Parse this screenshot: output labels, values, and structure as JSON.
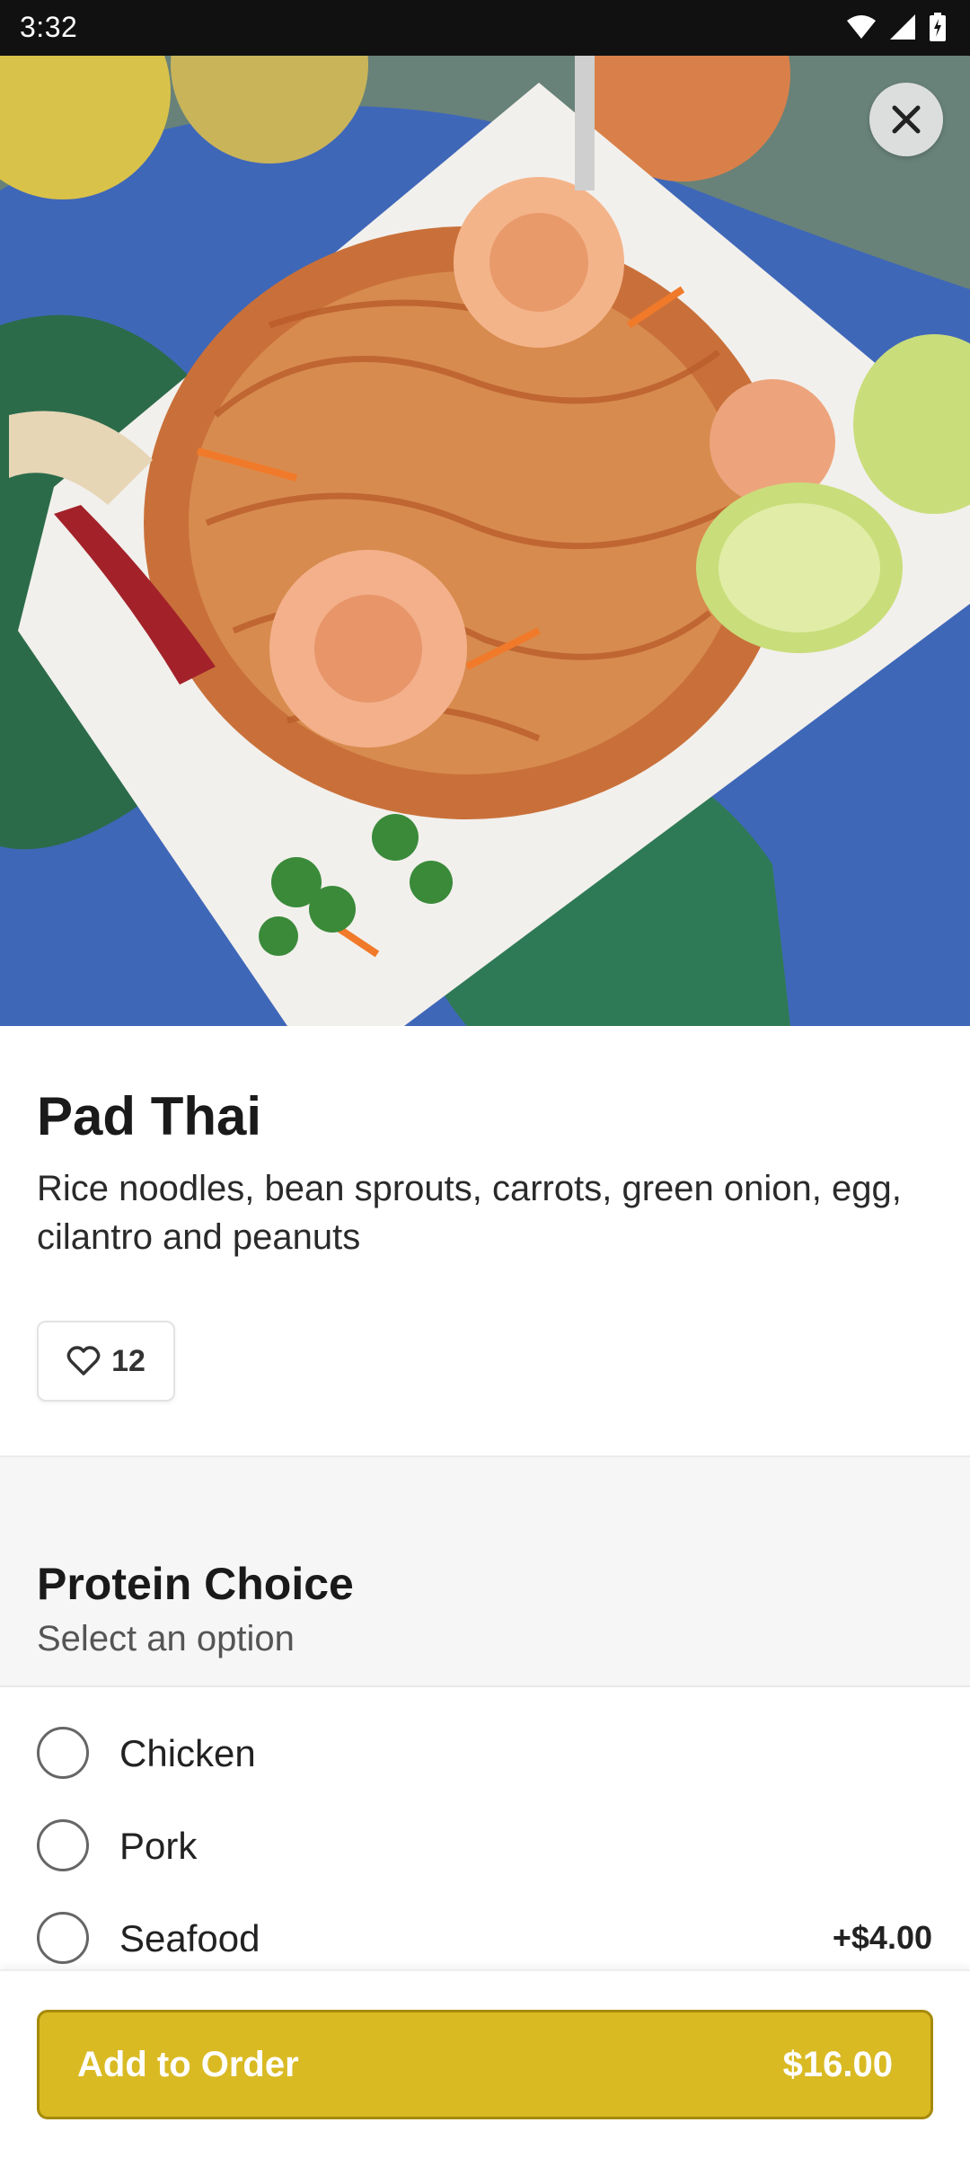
{
  "status_bar": {
    "time": "3:32"
  },
  "item": {
    "name": "Pad Thai",
    "description": "Rice noodles, bean sprouts, carrots, green onion, egg, cilantro and peanuts",
    "like_count": "12"
  },
  "section": {
    "title": "Protein Choice",
    "subtitle": "Select an option",
    "options": [
      {
        "label": "Chicken",
        "price": ""
      },
      {
        "label": "Pork",
        "price": ""
      },
      {
        "label": "Seafood",
        "price": "+$4.00"
      }
    ]
  },
  "order_button": {
    "label": "Add to Order",
    "amount": "$16.00"
  },
  "colors": {
    "accent": "#d9ba23",
    "accent_border": "#a68a07"
  },
  "icons": [
    "wifi-icon",
    "signal-icon",
    "battery-icon",
    "close-icon",
    "heart-icon"
  ]
}
